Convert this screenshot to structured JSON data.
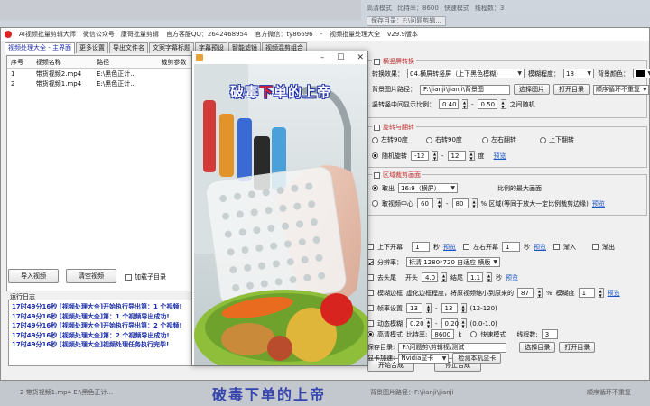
{
  "window": {
    "title": "AI视频批量剪辑大师",
    "wechat": "微信公众号：康哥批量剪辑",
    "qq": "官方客服QQ：2642468954",
    "official_wechat": "官方微信：ty86696",
    "module": "视频批量处理大全",
    "version": "v29.9版本"
  },
  "tabs": [
    "视频处理大全 - 主界面",
    "更多设置",
    "导出文件名",
    "文案字幕标题",
    "字幕预设",
    "智能滤镜",
    "视频混剪组合"
  ],
  "file_list": {
    "headers": [
      "序号",
      "视频名称",
      "路径",
      "裁剪参数"
    ],
    "rows": [
      {
        "index": "1",
        "name": "带货视频2.mp4",
        "path": "E:\\黑色正计...",
        "crop": ""
      },
      {
        "index": "2",
        "name": "带货视频1.mp4",
        "path": "E:\\黑色正计...",
        "crop": ""
      }
    ]
  },
  "buttons": {
    "import": "导入视频",
    "clear": "清空视频",
    "add_dir": "加载子目录",
    "start": "开始合成",
    "stop": "停止合成"
  },
  "log": {
    "label": "运行日志",
    "lines": [
      "17时49分16秒 [视频处理大全]开始执行导出第：1 个视频!",
      "17时49分16秒 [视频处理大全]第：1 个视频导出成功!",
      "17时49分16秒 [视频处理大全]开始执行导出第：2 个视频!",
      "17时49分16秒 [视频处理大全]第：2 个视频导出成功!",
      "17时49分16秒 [视频处理大全]视频处理任务执行完毕!"
    ]
  },
  "video_preview": {
    "caption_part1": "破",
    "caption_part2": "毒",
    "caption_part3": "下",
    "caption_part4": "单的上帝"
  },
  "settings": {
    "landscape": {
      "title": "横竖屏转换",
      "mode_label": "转换效果：",
      "mode_value": "04.横屏转竖屏（上下黑色模糊）",
      "blur_label": "模糊程度：",
      "blur_value": "18",
      "bgcolor_label": "背景颜色：",
      "bgcolor": "#000000",
      "bgpath_label": "背景图片路径：",
      "bgpath_value": "F:\\jianji\\jianji\\背景图",
      "select_image": "选择图片",
      "open_dir": "打开目录",
      "cycle_value": "顺序循环不重复",
      "ratio_label": "竖转竖中间显示比例：",
      "ratio_min": "0.40",
      "ratio_max": "0.50",
      "ratio_suffix": "之间随机"
    },
    "rotate": {
      "title": "旋转与翻转",
      "options": [
        "左转90度",
        "右转90度",
        "左右翻转",
        "上下翻转"
      ],
      "random_label": "随机旋转",
      "random_min": "-12",
      "random_max": "12",
      "unit": "度",
      "preview": "预览"
    },
    "crop": {
      "title": "区域裁剪画面",
      "take_label": "取出",
      "take_value": "16:9（横屏）",
      "take_desc": "比例的最大画面",
      "center_label": "取视频中心",
      "center_min": "60",
      "center_max": "80",
      "center_desc": "% 区域(等同于放大一定比例裁剪边缘)",
      "preview": "预览"
    },
    "flip_top_label": "上下开幕",
    "flip_top_value": "1",
    "flip_lr_label": "左右开幕",
    "flip_lr_value": "1",
    "sec": "秒",
    "preview": "预览",
    "fade_in": "渐入",
    "fade_out": "渐出",
    "resolution_label": "分辨率：",
    "resolution_value": "标清 1280*720 自适应 横版",
    "trim_label": "去头尾",
    "trim_head_label": "开头",
    "trim_head": "4.0",
    "trim_tail_label": "结尾",
    "trim_tail": "1.1",
    "border_label": "模糊边框",
    "border_desc": "虚化边框程度，将原视频缩小到原来的",
    "border_pct": "87",
    "border_pct_unit": "%",
    "border_blur_label": "模糊度",
    "border_blur": "1",
    "framerate_label": "帧率设置",
    "framerate_min": "13",
    "framerate_max": "13",
    "framerate_range": "(12-120)",
    "motion_label": "动态模糊",
    "motion_min": "0.20",
    "motion_max": "0.20",
    "motion_range": "(0.0-1.0)",
    "quality_hq": "高清模式",
    "bitrate_label": "比特率:",
    "bitrate": "8600",
    "bitrate_unit": "k",
    "quality_fast": "快速模式",
    "threads_label": "线程数:",
    "threads": "3",
    "save_label": "保存目录:",
    "save_path": "F:\\问题剪\\剪辑视\\测试",
    "select_dir": "选择目录",
    "open_dir": "打开目录",
    "gpu_label": "显卡加速:",
    "gpu_value": "Nvidia显卡",
    "detect_gpu": "检测本机显卡"
  },
  "background": {
    "top_mode": "高清模式",
    "top_bitrate": "比特率：8600",
    "top_fast": "快速模式",
    "top_threads": "线程数：3",
    "top_save": "保存目录：F:\\问题剪辑...",
    "bottom_row": "2  带货视频1.mp4  E:\\黑色正计...",
    "bottom_caption": "破毒下单的上帝",
    "bottom_bgpath": "背景图片路径：F:\\jianji\\jianji",
    "bottom_cycle": "顺序循环不重复"
  }
}
